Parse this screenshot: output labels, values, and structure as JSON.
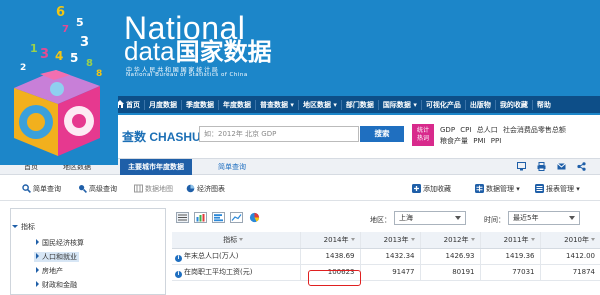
{
  "brand": {
    "en_title": "National",
    "data_word": "data",
    "cn_title": "国家数据",
    "sub_cn": "中华人民共和国国家统计局",
    "sub_en": "National Bureau of Statistics of China"
  },
  "mainnav": {
    "items": [
      "首页",
      "月度数据",
      "季度数据",
      "年度数据",
      "普查数据",
      "地区数据",
      "部门数据",
      "国际数据",
      "可视化产品",
      "出版物",
      "我的收藏",
      "帮助"
    ]
  },
  "search": {
    "logo_cn": "查数",
    "logo_en": "CHASHU",
    "placeholder": "如：2012年 北京 GDP",
    "button_label": "搜索",
    "badge_line1": "统计",
    "badge_line2": "热词",
    "hot_words": [
      "GDP",
      "CPI",
      "总人口",
      "社会消费品零售总额",
      "粮食产量",
      "PMI",
      "PPI"
    ]
  },
  "crumbs": {
    "home": "首页",
    "region": "地区数据",
    "active": "主要城市年度数据",
    "query": "简单查询"
  },
  "toolbar": {
    "simple_query": "简单查询",
    "advanced_query": "高级查询",
    "data_map": "数据地图",
    "charts": "经济图表",
    "add_favorite": "添加收藏",
    "data_manage": "数据管理",
    "table_manage": "报表管理"
  },
  "sidebar": {
    "root": "指标",
    "items": [
      "国民经济核算",
      "人口和就业",
      "房地产",
      "财政和金融"
    ],
    "selected_index": 1
  },
  "filters": {
    "region_label": "地区：",
    "region_value": "上海",
    "time_label": "时间：",
    "time_value": "最近5年"
  },
  "table": {
    "headers": [
      "指标",
      "2014年",
      "2013年",
      "2012年",
      "2011年",
      "2010年"
    ],
    "rows": [
      {
        "indicator": "年末总人口(万人)",
        "values": [
          "1438.69",
          "1432.34",
          "1426.93",
          "1419.36",
          "1412.00"
        ]
      },
      {
        "indicator": "在岗职工平均工资(元)",
        "values": [
          "100623",
          "91477",
          "80191",
          "77031",
          "71874"
        ]
      }
    ],
    "highlighted_cell": "100623",
    "highlight_color": "#e02020"
  },
  "colors": {
    "header_blue": "#1c86c9",
    "nav_dark": "#0d4e88",
    "accent_magenta": "#d82a8c",
    "button_blue": "#1f6fc0"
  }
}
